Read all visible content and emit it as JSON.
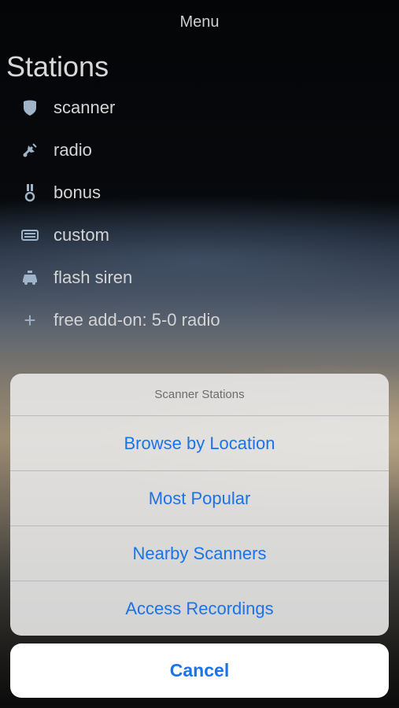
{
  "header": {
    "title": "Menu"
  },
  "stations": {
    "title": "Stations",
    "items": [
      {
        "label": "scanner",
        "icon": "shield-icon"
      },
      {
        "label": "radio",
        "icon": "satellite-icon"
      },
      {
        "label": "bonus",
        "icon": "medal-icon"
      },
      {
        "label": "custom",
        "icon": "keyboard-icon"
      },
      {
        "label": "flash siren",
        "icon": "police-car-icon"
      },
      {
        "label": "free add-on: 5-0 radio",
        "icon": "plus-icon",
        "glyph": "+"
      }
    ]
  },
  "action_sheet": {
    "title": "Scanner Stations",
    "buttons": [
      "Browse by Location",
      "Most Popular",
      "Nearby Scanners",
      "Access Recordings"
    ],
    "cancel": "Cancel"
  },
  "colors": {
    "accent": "#1a73e8",
    "icon": "#9fb4c8"
  }
}
